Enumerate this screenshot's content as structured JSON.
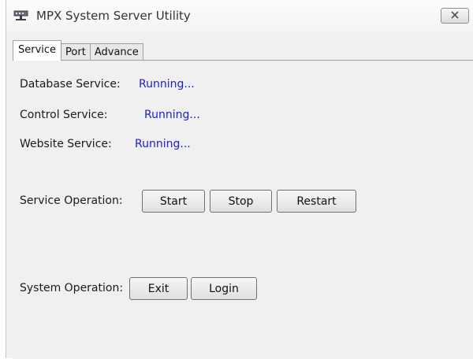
{
  "window": {
    "title": "MPX System Server Utility",
    "app_icon": "server-icon",
    "close_icon": "close-icon"
  },
  "tabs": [
    {
      "label": "Service",
      "active": true
    },
    {
      "label": "Port",
      "active": false
    },
    {
      "label": "Advance",
      "active": false
    }
  ],
  "services": [
    {
      "label": "Database Service:",
      "status": "Running..."
    },
    {
      "label": "Control Service:",
      "status": "Running..."
    },
    {
      "label": "Website Service:",
      "status": "Running..."
    }
  ],
  "service_operation": {
    "label": "Service Operation:",
    "start": "Start",
    "stop": "Stop",
    "restart": "Restart"
  },
  "system_operation": {
    "label": "System Operation:",
    "exit": "Exit",
    "login": "Login"
  },
  "colors": {
    "status_text": "#1c1ccc",
    "window_bg": "#f0f0f0"
  }
}
